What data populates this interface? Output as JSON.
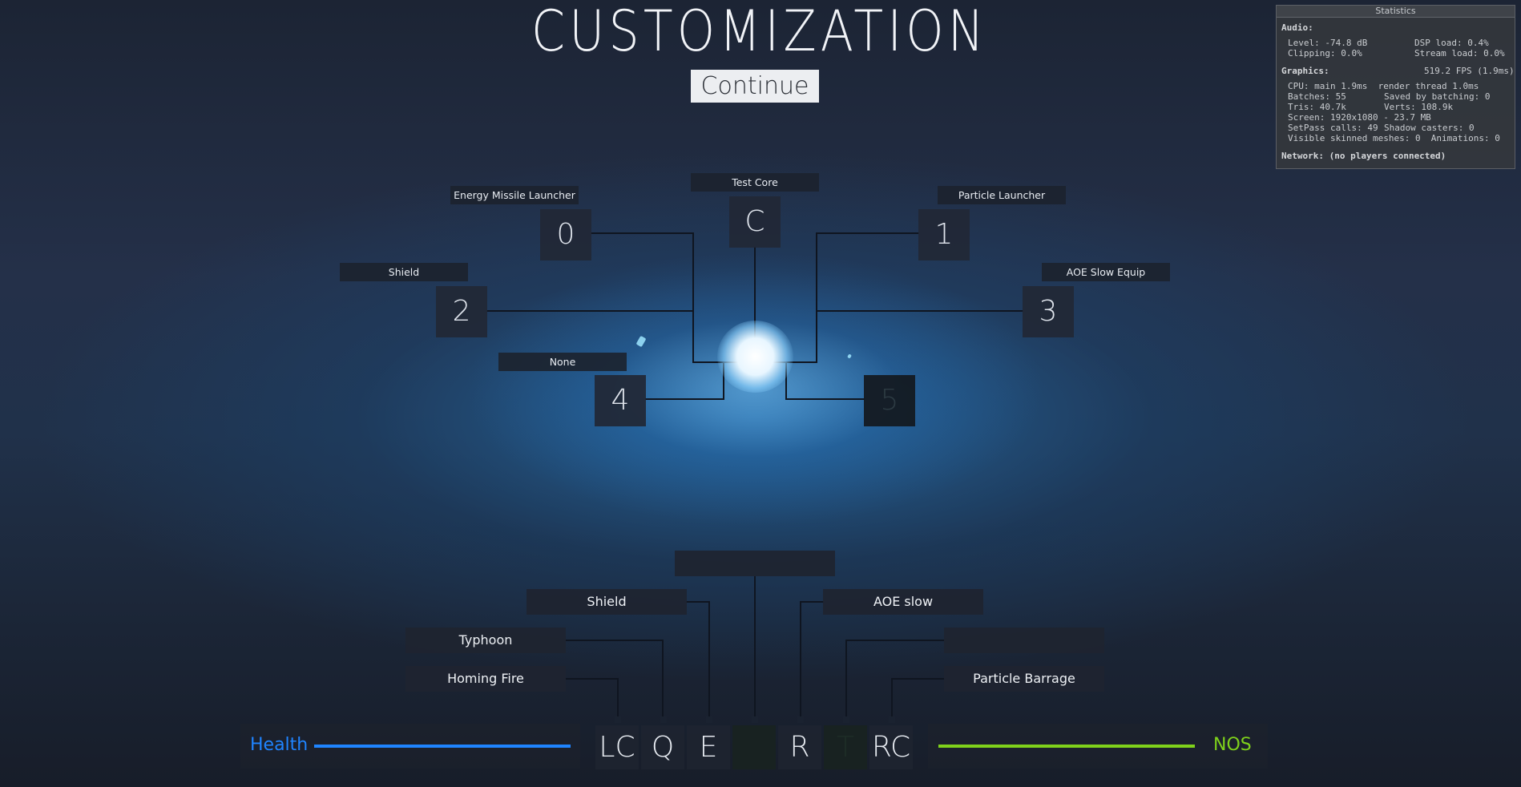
{
  "title": "CUSTOMIZATION",
  "continue_label": "Continue",
  "core": {
    "label": "Test Core",
    "key": "C"
  },
  "slots": [
    {
      "label": "Energy Missile Launcher",
      "key": "0"
    },
    {
      "label": "Particle Launcher",
      "key": "1"
    },
    {
      "label": "Shield",
      "key": "2"
    },
    {
      "label": "AOE Slow Equip",
      "key": "3"
    },
    {
      "label": "None",
      "key": "4"
    },
    {
      "label": "",
      "key": "5"
    }
  ],
  "abilities": {
    "top": "",
    "shield": "Shield",
    "aoe_slow": "AOE slow",
    "typhoon": "Typhoon",
    "empty_right": "",
    "homing_fire": "Homing Fire",
    "particle_barrage": "Particle Barrage"
  },
  "hotkeys": [
    "LC",
    "Q",
    "E",
    "",
    "R",
    "T",
    "RC"
  ],
  "hud": {
    "health_label": "Health",
    "health_fraction": 1.0,
    "nos_label": "NOS",
    "nos_fraction": 1.0,
    "health_color": "#1f84ff",
    "nos_color": "#7fd11b"
  },
  "stats": {
    "title": "Statistics",
    "audio_header": "Audio:",
    "level": "Level: -74.8 dB",
    "dsp_load": "DSP load: 0.4%",
    "clipping": "Clipping: 0.0%",
    "stream_load": "Stream load: 0.0%",
    "graphics_header": "Graphics:",
    "fps": "519.2 FPS (1.9ms)",
    "cpu": "CPU: main 1.9ms  render thread 1.0ms",
    "batches": "Batches: 55",
    "saved_batching": "Saved by batching: 0",
    "tris": "Tris: 40.7k",
    "verts": "Verts: 108.9k",
    "screen": "Screen: 1920x1080 - 23.7 MB",
    "setpass": "SetPass calls: 49",
    "shadow_casters": "Shadow casters: 0",
    "skinned": "Visible skinned meshes: 0  Animations: 0",
    "network": "Network: (no players connected)"
  }
}
